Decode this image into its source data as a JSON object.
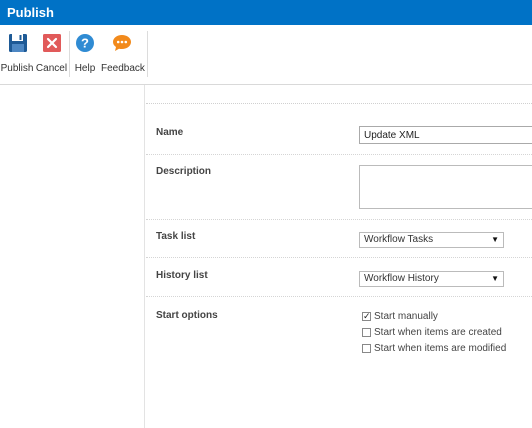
{
  "window": {
    "title": "Publish"
  },
  "ribbon": {
    "buttons": [
      {
        "label": "Publish",
        "icon": "save-icon"
      },
      {
        "label": "Cancel",
        "icon": "close-icon"
      },
      {
        "label": "Help",
        "icon": "help-icon"
      },
      {
        "label": "Feedback",
        "icon": "chat-icon"
      }
    ]
  },
  "form": {
    "name": {
      "label": "Name",
      "value": "Update XML"
    },
    "description": {
      "label": "Description",
      "value": ""
    },
    "task_list": {
      "label": "Task list",
      "selected": "Workflow Tasks"
    },
    "history_list": {
      "label": "History list",
      "selected": "Workflow History"
    },
    "start_options": {
      "label": "Start options",
      "options": [
        {
          "label": "Start manually",
          "checked": true
        },
        {
          "label": "Start when items are created",
          "checked": false
        },
        {
          "label": "Start when items are modified",
          "checked": false
        }
      ]
    }
  },
  "colors": {
    "titlebar": "#0072c6",
    "save_icon": "#1e5a96",
    "cancel_icon": "#e15a5a",
    "help_icon": "#2f8bd3",
    "feedback_icon": "#f28a1c"
  }
}
